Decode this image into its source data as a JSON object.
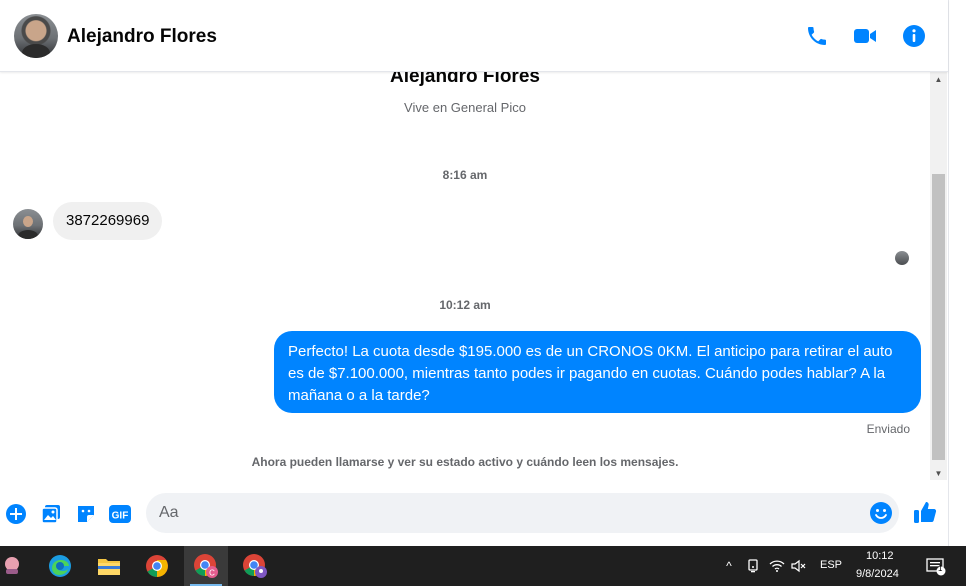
{
  "header": {
    "contact_name": "Alejandro Flores",
    "icons": [
      "phone-icon",
      "video-camera-icon",
      "info-icon"
    ],
    "accent_color": "#0084ff"
  },
  "chat": {
    "profile_name": "Alejandro Flores",
    "profile_subtitle": "Vive en General Pico",
    "timestamp_1": "8:16 am",
    "incoming_message": "3872269969",
    "timestamp_2": "10:12 am",
    "outgoing_message": "Perfecto! La cuota desde $195.000 es de un CRONOS 0KM. El anticipo para retirar el auto es de $7.100.000, mientras tanto podes ir pagando en cuotas. Cuándo podes hablar? A la mañana o a la tarde?",
    "sent_status": "Enviado",
    "notice": "Ahora pueden llamarse y ver su estado activo y cuándo leen los mensajes."
  },
  "composer": {
    "placeholder": "Aa",
    "gif_label": "GIF",
    "icons": [
      "plus-circle-icon",
      "photo-icon",
      "sticker-icon",
      "gif-icon",
      "emoji-icon",
      "thumbs-up-icon"
    ]
  },
  "taskbar": {
    "apps": [
      "app-icon",
      "edge-icon",
      "file-explorer-icon",
      "chrome-icon",
      "chrome-profile-icon",
      "chrome-profile-2-icon"
    ],
    "language": "ESP",
    "time": "10:12",
    "date": "9/8/2024",
    "notification_count": "1"
  }
}
